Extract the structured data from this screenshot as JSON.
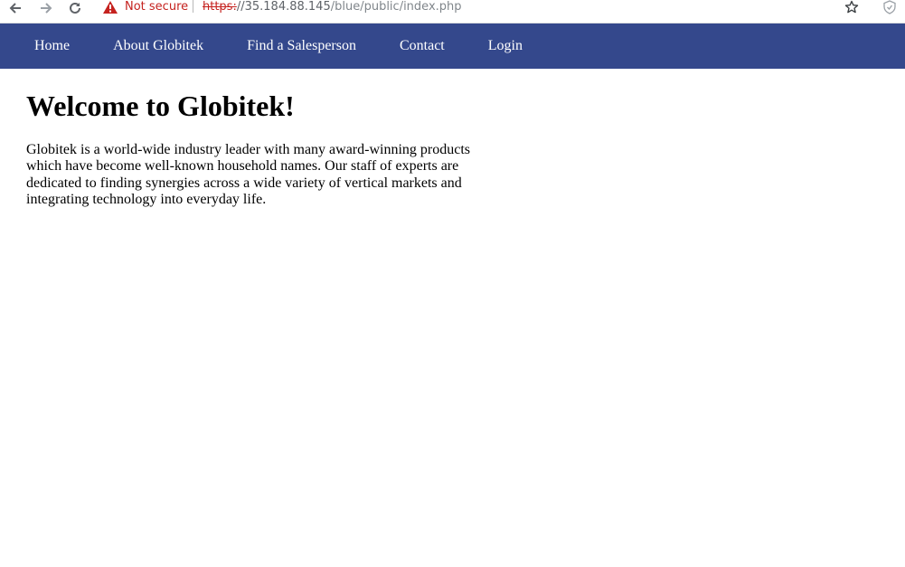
{
  "browser": {
    "security_label": "Not secure",
    "url_scheme": "https:",
    "url_host": "//35.184.88.145",
    "url_path": "/blue/public/index.php",
    "icons": [
      "back-arrow-icon",
      "forward-arrow-icon",
      "reload-icon",
      "warning-icon",
      "star-icon",
      "extension-icon"
    ],
    "colors": {
      "insecure": "#c5221f"
    }
  },
  "nav": {
    "background": "#34488c",
    "items": [
      {
        "label": "Home"
      },
      {
        "label": "About Globitek"
      },
      {
        "label": "Find a Salesperson"
      },
      {
        "label": "Contact"
      },
      {
        "label": "Login"
      }
    ]
  },
  "main": {
    "heading": "Welcome to Globitek!",
    "intro": "Globitek is a world-wide industry leader with many award-winning products which have become well-known household names. Our staff of experts are dedicated to finding synergies across a wide variety of vertical markets and integrating technology into everyday life."
  }
}
